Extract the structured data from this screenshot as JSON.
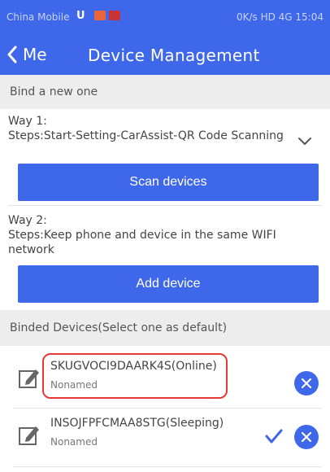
{
  "status_bar": {
    "carrier": "China Mobile",
    "carrier_badge": "U",
    "network_info": "0K/s HD 4G 15:04"
  },
  "nav": {
    "back_label": "Me",
    "title": "Device Management"
  },
  "bind_section": {
    "header": "Bind a new one",
    "way1_title": "Way 1:",
    "way1_steps": "Steps:Start-Setting-CarAssist-QR Code Scanning",
    "scan_button": "Scan devices",
    "way2_title": "Way 2:",
    "way2_steps": "Steps:Keep phone and device in the same WIFI network",
    "add_button": "Add device"
  },
  "binded_section": {
    "header": "Binded Devices(Select one as default)",
    "devices": [
      {
        "name": "SKUGVOCI9DAARK4S(Online)",
        "alias": "Nonamed",
        "is_default": false
      },
      {
        "name": "INSOJFPFCMAA8STG(Sleeping)",
        "alias": "Nonamed",
        "is_default": true
      }
    ]
  },
  "colors": {
    "primary": "#3f67e9",
    "section_bg": "#ededed",
    "highlight": "#e53935"
  }
}
